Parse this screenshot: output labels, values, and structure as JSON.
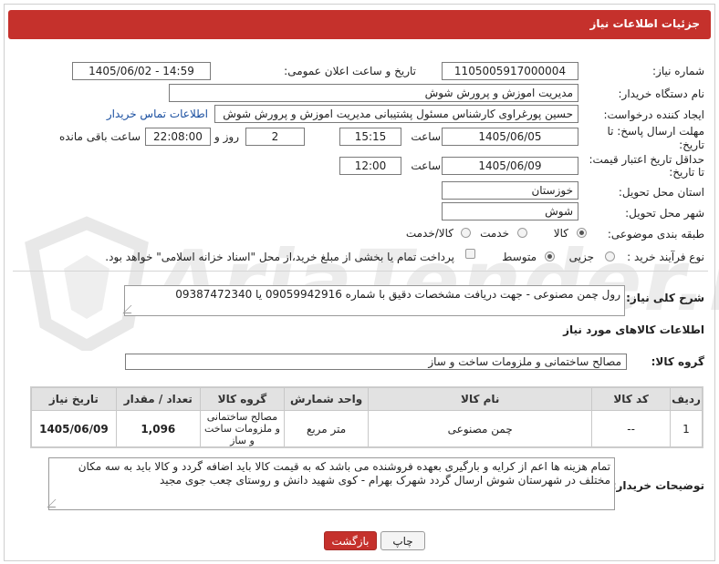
{
  "header": {
    "title": "جزئیات اطلاعات نیاز"
  },
  "fields": {
    "need_number": {
      "label": "شماره نیاز:",
      "value": "1105005917000004"
    },
    "announce_datetime": {
      "label": "تاریخ و ساعت اعلان عمومی:",
      "value": "1405/06/02 - 14:59"
    },
    "buyer_org": {
      "label": "نام دستگاه خریدار:",
      "value": "مدیریت اموزش و پرورش شوش"
    },
    "requester": {
      "label": "ایجاد کننده درخواست:",
      "value": "حسین پورغراوی کارشناس مسئول پشتیبانی مدیریت اموزش و پرورش شوش",
      "link": "اطلاعات تماس خریدار"
    },
    "reply_deadline": {
      "label_line1": "مهلت ارسال پاسخ: تا",
      "label_line2": "تاریخ:",
      "date": "1405/06/05",
      "time_label": "ساعت",
      "time": "15:15",
      "days": "2",
      "days_label": "روز و",
      "remaining": "22:08:00",
      "remaining_label": "ساعت باقی مانده"
    },
    "price_validity": {
      "label_line1": "حداقل تاریخ اعتبار قیمت:",
      "label_line2": "تا تاریخ:",
      "date": "1405/06/09",
      "time_label": "ساعت",
      "time": "12:00"
    },
    "delivery_province": {
      "label": "استان محل تحویل:",
      "value": "خوزستان"
    },
    "delivery_city": {
      "label": "شهر محل تحویل:",
      "value": "شوش"
    },
    "category": {
      "label": "طبقه بندی موضوعی:",
      "options": [
        "کالا",
        "خدمت",
        "کالا/خدمت"
      ],
      "selected": 0
    },
    "process": {
      "label": "نوع فرآیند خرید :",
      "options": [
        "جزیی",
        "متوسط"
      ],
      "selected": 1,
      "note": "پرداخت تمام یا بخشی از مبلغ خرید،از محل \"اسناد خزانه اسلامی\" خواهد بود."
    }
  },
  "summary": {
    "label": "شرح کلی نیاز:",
    "value": "رول چمن مصنوعی - جهت دریافت مشخصات دقیق با شماره 09059942916 یا 09387472340"
  },
  "goods_info": {
    "title": "اطلاعات کالاهای مورد نیاز"
  },
  "goods_group": {
    "label": "گروه کالا:",
    "value": "مصالح ساختمانی و ملزومات ساخت و ساز"
  },
  "table": {
    "headers": [
      "ردیف",
      "کد کالا",
      "نام کالا",
      "واحد شمارش",
      "گروه کالا",
      "تعداد / مقدار",
      "تاریخ نیاز"
    ],
    "rows": [
      {
        "index": "1",
        "code": "--",
        "name": "چمن مصنوعی",
        "unit": "متر مربع",
        "group": "مصالح ساختمانی و ملزومات ساخت و ساز",
        "qty": "1,096",
        "date": "1405/06/09"
      }
    ]
  },
  "buyer_notes": {
    "label": "توضیحات خریدار:",
    "value": "تمام هزینه ها اعم از کرایه و بارگیری بعهده فروشنده می باشد که به قیمت کالا باید اضافه گردد و کالا باید به سه مکان مختلف در شهرستان شوش ارسال گردد شهرک بهرام - کوی شهید دانش و روستای چعب جوی مجید"
  },
  "buttons": {
    "print": "چاپ",
    "back": "بازگشت"
  },
  "watermark": {
    "text": "AriaTender.net"
  }
}
